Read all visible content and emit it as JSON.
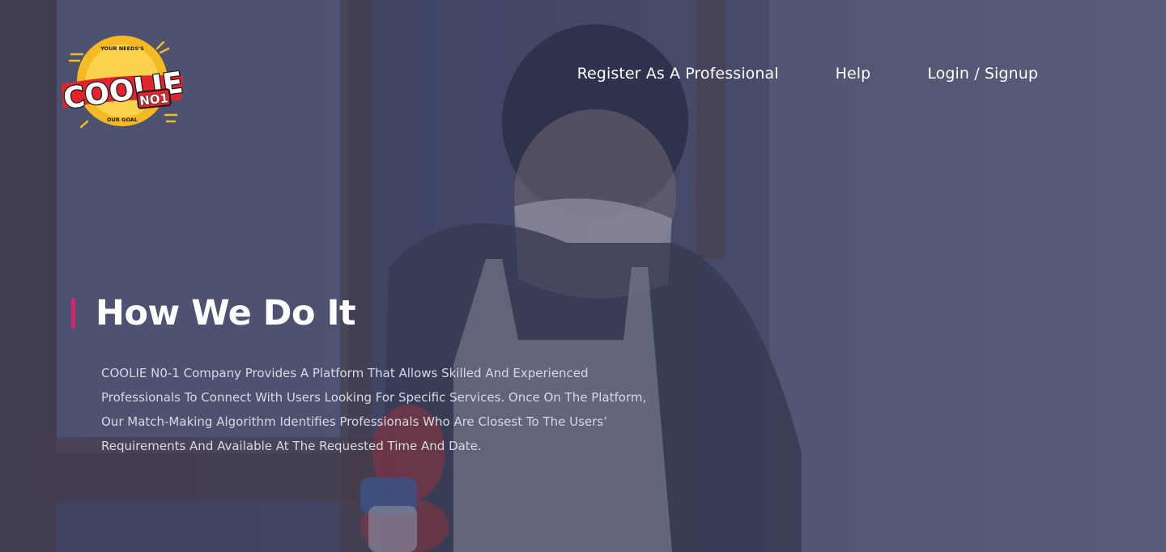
{
  "logo": {
    "main_text": "COOLIE",
    "badge_text": "NO1",
    "top_arc_text": "YOUR NEEDS'S",
    "bottom_arc_text": "OUR GOAL",
    "colors": {
      "ring": "#f5b923",
      "word_fill": "#ffffff",
      "word_outline": "#1a1a1a",
      "banner": "#e2242d"
    }
  },
  "nav": {
    "items": [
      {
        "label": "Register As A Professional"
      },
      {
        "label": "Help"
      },
      {
        "label": "Login / Signup"
      }
    ]
  },
  "hero": {
    "title": "How We Do It",
    "description": "COOLIE N0-1 Company Provides A Platform That Allows Skilled And Experienced Professionals To Connect With Users Looking For Specific Services. Once On The Platform, Our Match-Making Algorithm Identifies Professionals Who Are Closest To The Users’ Requirements And Available At The Requested Time And Date.",
    "accent_color": "#d6236a"
  }
}
